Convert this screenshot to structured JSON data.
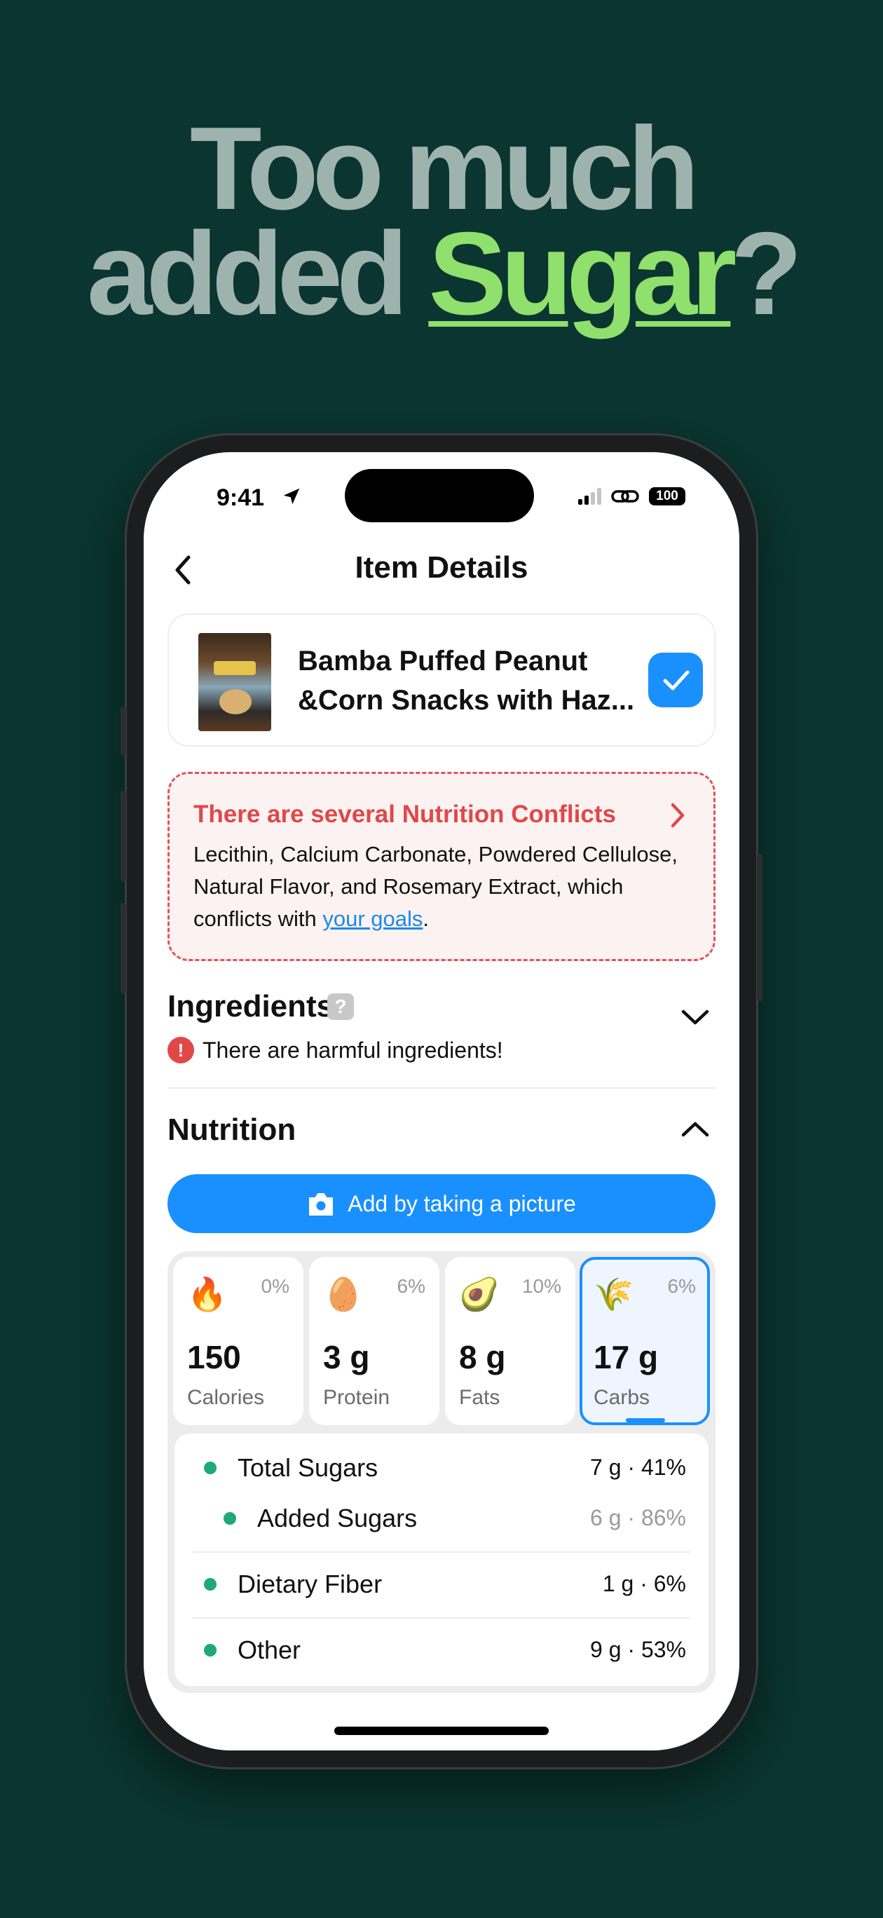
{
  "headline": {
    "line1": "Too much",
    "line2_before": "added ",
    "line2_accent": "Sugar",
    "line2_after": "?"
  },
  "status_bar": {
    "time": "9:41",
    "battery": "100"
  },
  "nav": {
    "title": "Item Details"
  },
  "product": {
    "name": "Bamba Puffed Peanut &Corn Snacks with Haz..."
  },
  "conflict": {
    "title": "There are several Nutrition Conflicts",
    "body_before": "Lecithin, Calcium Carbonate, Powdered Cellulose, Natural Flavor, and Rosemary Extract, which conflicts with ",
    "link": "your goals",
    "body_after": "."
  },
  "ingredients": {
    "title": "Ingredients",
    "help": "?",
    "warning_icon": "!",
    "warning": "There are harmful ingredients!"
  },
  "nutrition": {
    "title": "Nutrition",
    "add_button": "Add by taking a picture",
    "macros": [
      {
        "icon": "🔥",
        "pct": "0%",
        "value": "150",
        "label": "Calories"
      },
      {
        "icon": "🥚",
        "pct": "6%",
        "value": "3 g",
        "label": "Protein"
      },
      {
        "icon": "🥑",
        "pct": "10%",
        "value": "8 g",
        "label": "Fats"
      },
      {
        "icon": "🌾",
        "pct": "6%",
        "value": "17 g",
        "label": "Carbs"
      }
    ],
    "breakdown": [
      {
        "name": "Total Sugars",
        "amount": "7 g · 41%"
      },
      {
        "name": "Added Sugars",
        "amount": "6 g · 86%"
      },
      {
        "name": "Dietary Fiber",
        "amount": "1 g · 6%"
      },
      {
        "name": "Other",
        "amount": "9 g · 53%"
      }
    ]
  },
  "colors": {
    "background": "#0a3530",
    "accent_green": "#8fe06c",
    "primary_blue": "#1a90ff",
    "conflict_red": "#e04848",
    "dot_green": "#1fa87a"
  }
}
